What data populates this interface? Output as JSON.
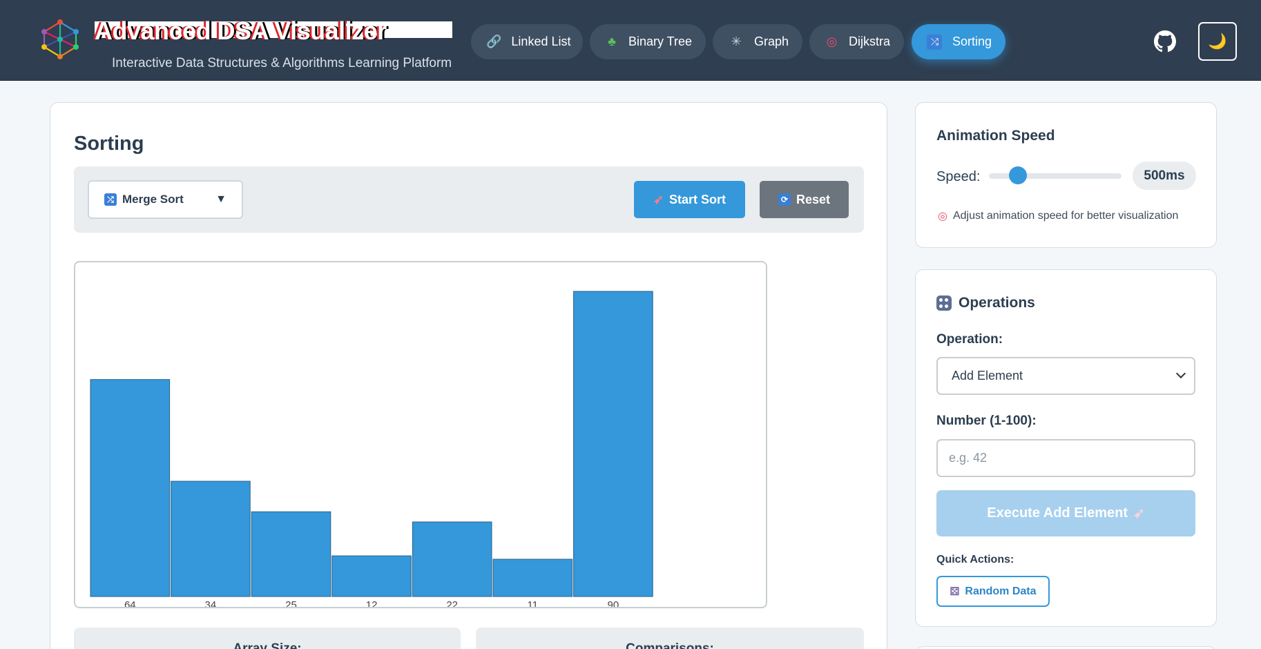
{
  "header": {
    "title": "Advanced DSA Visualizer",
    "subtitle": "Interactive Data Structures & Algorithms Learning Platform",
    "nav": [
      {
        "label": "Linked List",
        "icon": "link-icon"
      },
      {
        "label": "Binary Tree",
        "icon": "tree-icon"
      },
      {
        "label": "Graph",
        "icon": "web-icon"
      },
      {
        "label": "Dijkstra",
        "icon": "target-icon"
      },
      {
        "label": "Sorting",
        "icon": "shuffle-icon",
        "active": true
      }
    ],
    "github_icon": "github-icon",
    "theme_icon": "moon-icon",
    "theme_glyph": "🌙"
  },
  "main": {
    "title": "Sorting",
    "algorithm": "Merge Sort",
    "start_label": "Start Sort",
    "reset_label": "Reset",
    "stats": [
      {
        "label": "Array Size:"
      },
      {
        "label": "Comparisons:"
      }
    ]
  },
  "chart_data": {
    "type": "bar",
    "categories": [
      "64",
      "34",
      "25",
      "12",
      "22",
      "11",
      "90"
    ],
    "values": [
      64,
      34,
      25,
      12,
      22,
      11,
      90
    ],
    "bar_color": "#3498db",
    "title": "",
    "xlabel": "",
    "ylabel": ""
  },
  "speed": {
    "title": "Animation Speed",
    "label": "Speed:",
    "value": "500ms",
    "level": 0.22,
    "hint": "Adjust animation speed for better visualization"
  },
  "operations": {
    "title": "Operations",
    "operation_label": "Operation:",
    "operation_value": "Add Element",
    "number_label": "Number (1-100):",
    "number_placeholder": "e.g. 42",
    "execute_label": "Execute Add Element",
    "quick_label": "Quick Actions:",
    "random_label": "Random Data"
  },
  "colors": {
    "header_bg": "#2f3e50",
    "accent": "#3498db",
    "reset_gray": "#6c757d"
  }
}
